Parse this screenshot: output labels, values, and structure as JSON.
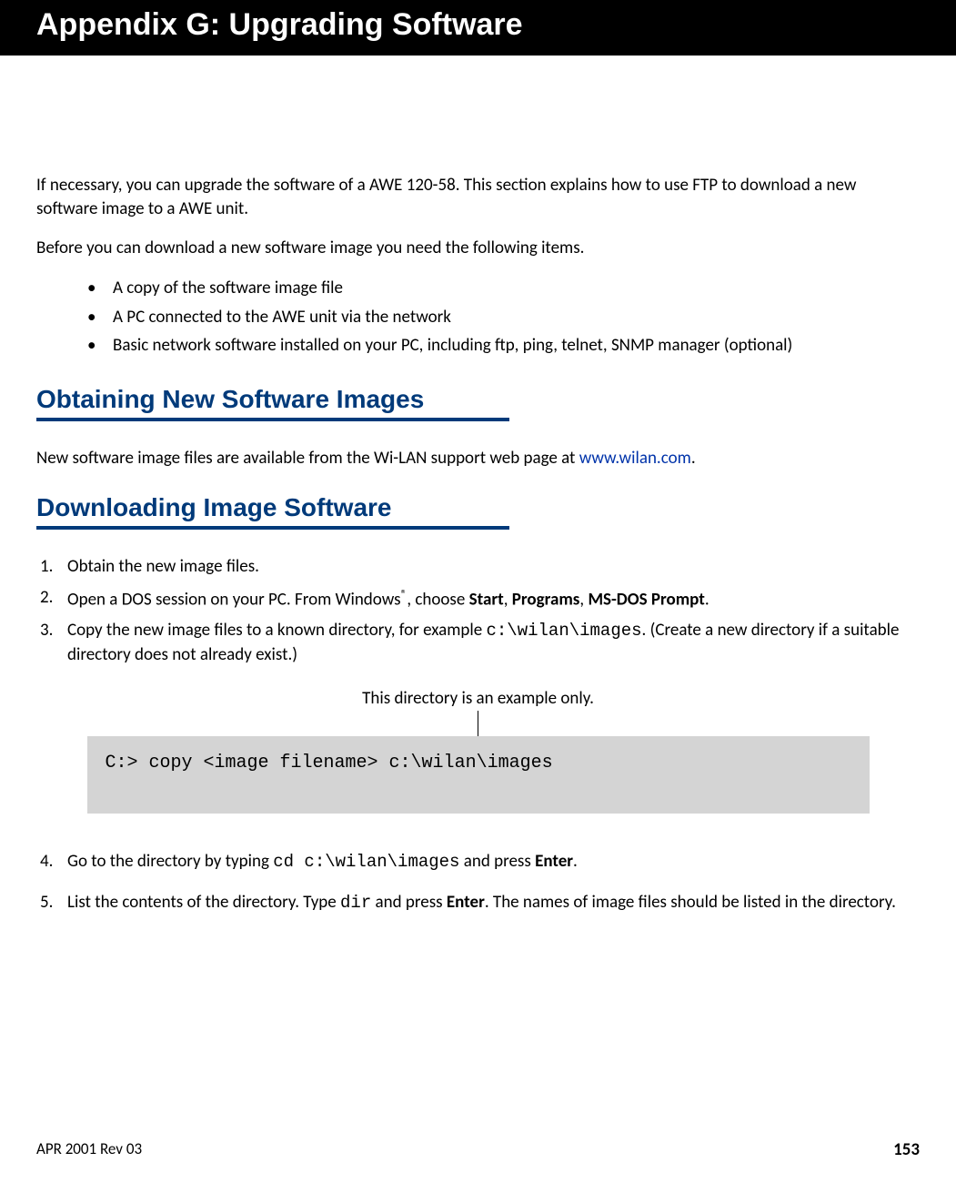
{
  "header": {
    "title": "Appendix G: Upgrading Software"
  },
  "intro": {
    "p1": "If necessary, you can upgrade the software of a AWE 120-58. This section explains how to use FTP to download a new software image to a AWE unit.",
    "p2": "Before you can download a new software image you need the following items.",
    "bullets": [
      "A copy of the software image file",
      "A PC connected to the AWE unit via the network",
      "Basic network software installed on your PC, including ftp, ping, telnet, SNMP manager (optional)"
    ]
  },
  "sec1": {
    "heading": "Obtaining New Software Images",
    "p1a": "New software image files are available from the Wi-LAN support web page at ",
    "link": "www.wilan.com",
    "p1b": "."
  },
  "sec2": {
    "heading": "Downloading Image Software",
    "steps": {
      "s1": "Obtain the new image files.",
      "s2a": "Open a DOS session on your PC. From Windows",
      "s2reg": "®",
      "s2b": ", choose ",
      "s2c": "Start",
      "s2d": ", ",
      "s2e": "Programs",
      "s2f": ", ",
      "s2g": "MS-DOS Prompt",
      "s2h": ".",
      "s3a": "Copy the new image files to a known directory, for example ",
      "s3path": "c:\\wilan\\images",
      "s3b": ". (Create a new directory if a suitable directory does not already exist.)",
      "s4a": "Go to the directory by typing ",
      "s4cmd": "cd c:\\wilan\\images",
      "s4b": " and press ",
      "s4enter": "Enter",
      "s4c": ".",
      "s5a": "List the contents of the directory. Type ",
      "s5cmd": "dir",
      "s5b": " and press ",
      "s5enter": "Enter",
      "s5c": ". The names of image files should be listed in the directory."
    },
    "callout": {
      "label": "This directory is an example only.",
      "code": "C:> copy <image filename> c:\\wilan\\images"
    }
  },
  "footer": {
    "left": "APR 2001 Rev 03",
    "right": "153"
  }
}
